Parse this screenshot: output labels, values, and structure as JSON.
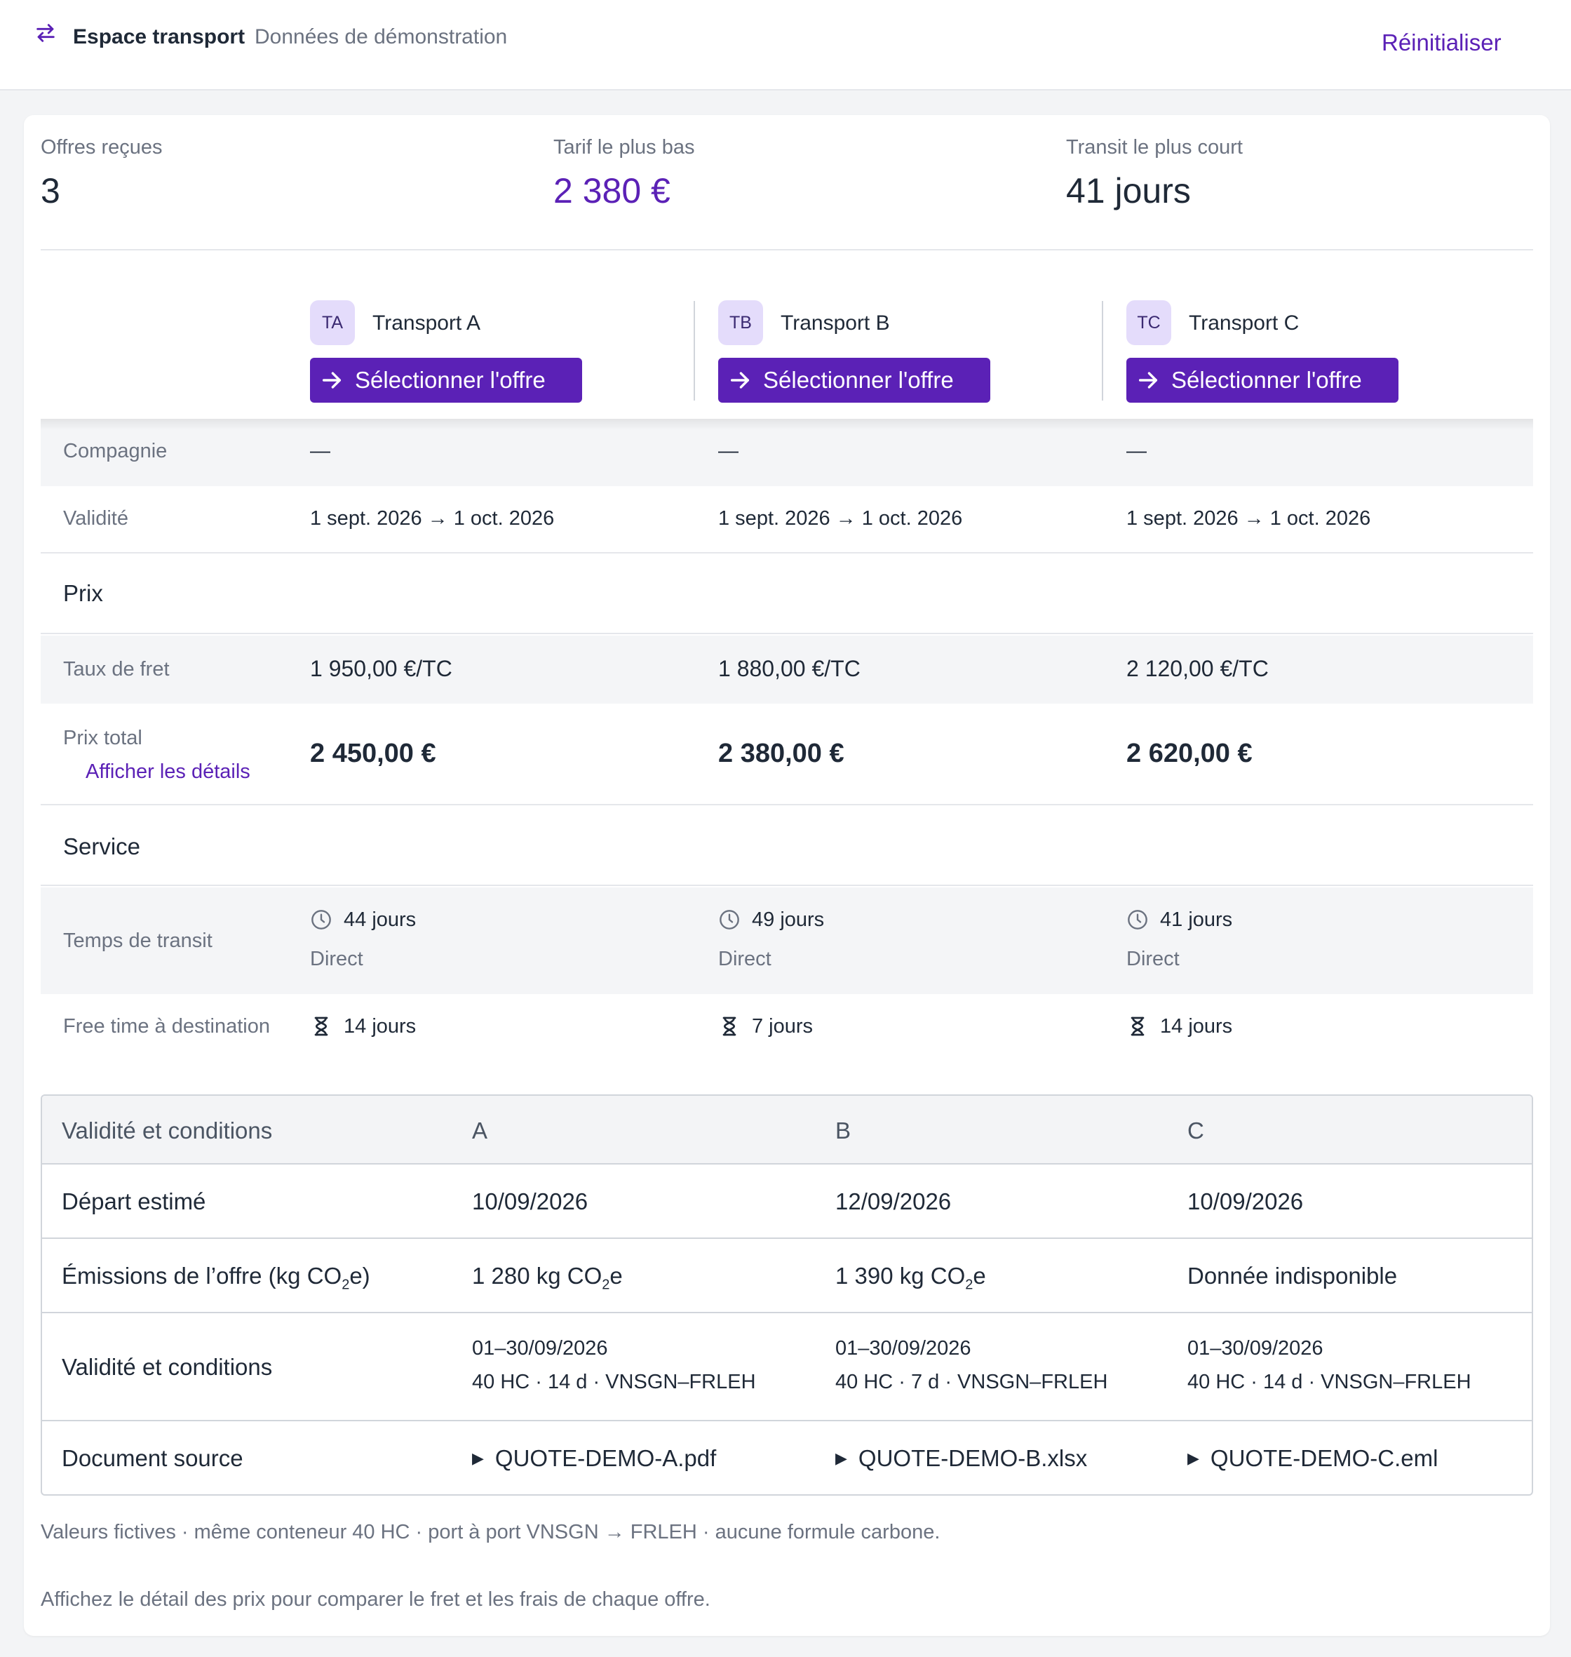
{
  "app": {
    "title": "Espace transport",
    "subtitle": "Données de démonstration",
    "reset_label": "Réinitialiser"
  },
  "stats": [
    {
      "label": "Offres reçues",
      "value": "3"
    },
    {
      "label": "Tarif le plus bas",
      "value": "2 380 €"
    },
    {
      "label": "Transit le plus court",
      "value": "41 jours"
    }
  ],
  "carriers": [
    {
      "badge": "TA",
      "name": "Transport A",
      "select_label": "Sélectionner l'offre"
    },
    {
      "badge": "TB",
      "name": "Transport B",
      "select_label": "Sélectionner l'offre"
    },
    {
      "badge": "TC",
      "name": "Transport C",
      "select_label": "Sélectionner l'offre"
    }
  ],
  "rows": {
    "compagnie": {
      "label": "Compagnie",
      "values": [
        "—",
        "—",
        "—"
      ]
    },
    "validite": {
      "label": "Validité",
      "values": [
        "1 sept. 2026 → 1 oct. 2026",
        "1 sept. 2026 → 1 oct. 2026",
        "1 sept. 2026 → 1 oct. 2026"
      ]
    },
    "prix_section": "Prix",
    "taux_fret": {
      "label": "Taux de fret",
      "values": [
        "1 950,00 €/TC",
        "1 880,00 €/TC",
        "2 120,00 €/TC"
      ]
    },
    "prix_total": {
      "label": "Prix total",
      "details_label": "Afficher les détails",
      "values": [
        "2 450,00 €",
        "2 380,00 €",
        "2 620,00 €"
      ]
    },
    "service_section": "Service",
    "transit": {
      "label": "Temps de transit",
      "values": [
        "44 jours",
        "49 jours",
        "41 jours"
      ],
      "routing": [
        "Direct",
        "Direct",
        "Direct"
      ]
    },
    "free_time": {
      "label": "Free time à destination",
      "values": [
        "14 jours",
        "7 jours",
        "14 jours"
      ]
    }
  },
  "conditions_table": {
    "headers": [
      "Validité et conditions",
      "A",
      "B",
      "C"
    ],
    "rows": [
      {
        "label": "Départ estimé",
        "values": [
          "10/09/2026",
          "12/09/2026",
          "10/09/2026"
        ]
      },
      {
        "label_pre": "Émissions de l’offre (kg CO",
        "label_sub": "2",
        "label_post": "e)",
        "values": [
          {
            "pre": "1 280 kg CO",
            "sub": "2",
            "post": "e"
          },
          {
            "pre": "1 390 kg CO",
            "sub": "2",
            "post": "e"
          },
          {
            "pre": "Donnée indisponible",
            "sub": "",
            "post": ""
          }
        ]
      },
      {
        "label": "Validité et conditions",
        "values": [
          {
            "line1": "01–30/09/2026",
            "line2": "40 HC · 14 d · VNSGN–FRLEH"
          },
          {
            "line1": "01–30/09/2026",
            "line2": "40 HC · 7 d · VNSGN–FRLEH"
          },
          {
            "line1": "01–30/09/2026",
            "line2": "40 HC · 14 d · VNSGN–FRLEH"
          }
        ]
      },
      {
        "label": "Document source",
        "values": [
          "QUOTE-DEMO-A.pdf",
          "QUOTE-DEMO-B.xlsx",
          "QUOTE-DEMO-C.eml"
        ]
      }
    ]
  },
  "notes": [
    "Valeurs fictives · même conteneur 40 HC · port à port VNSGN → FRLEH · aucune formule carbone.",
    "Affichez le détail des prix pour comparer le fret et les frais de chaque offre."
  ],
  "colors": {
    "accent": "#5b21b6",
    "badge_bg": "#e4dcfb",
    "shaded_row": "#f4f5f7"
  }
}
